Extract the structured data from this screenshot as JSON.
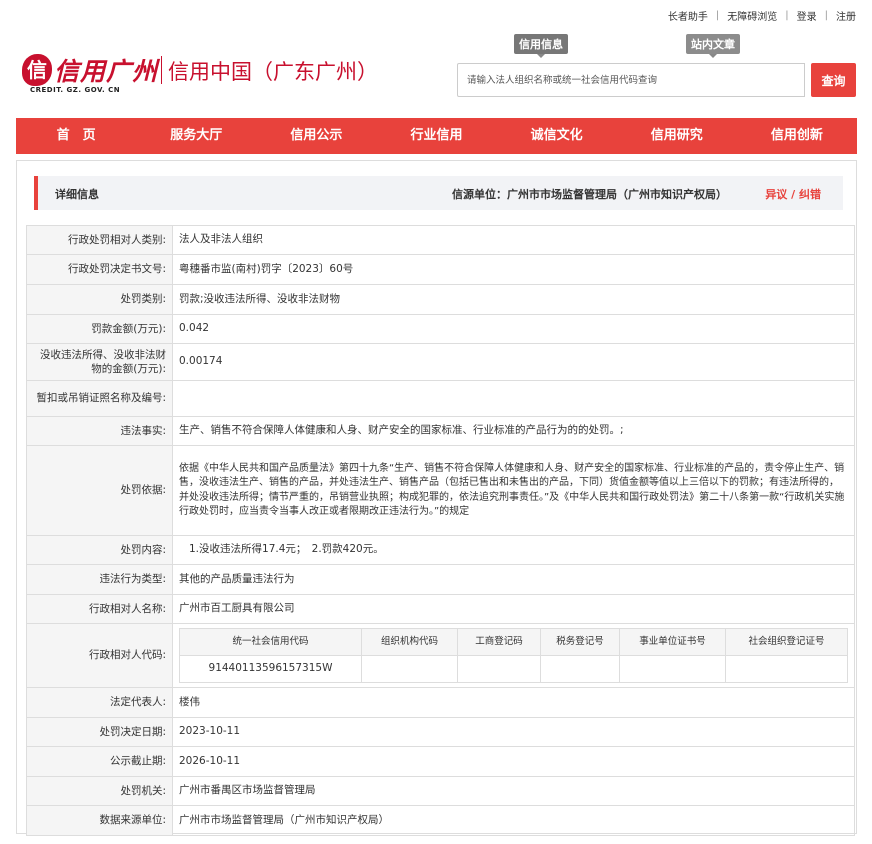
{
  "toplinks": {
    "elder": "长者助手",
    "accessible": "无障碍浏览",
    "login": "登录",
    "register": "注册"
  },
  "logo": {
    "mark": "信",
    "name": "信用广州",
    "en": "CREDIT. GZ. GOV. CN",
    "sub": "信用中国（广东广州）"
  },
  "search": {
    "tab1": "信用信息",
    "tab2": "站内文章",
    "placeholder": "请输入法人组织名称或统一社会信用代码查询",
    "button": "查询"
  },
  "nav": [
    "首　页",
    "服务大厅",
    "信用公示",
    "行业信用",
    "诚信文化",
    "信用研究",
    "信用创新"
  ],
  "detail": {
    "title": "详细信息",
    "source": "信源单位：广州市市场监督管理局（广州市知识产权局）",
    "objection": "异议 / 纠错"
  },
  "rows": {
    "r1": {
      "label": "行政处罚相对人类别:",
      "value": "法人及非法人组织"
    },
    "r2": {
      "label": "行政处罚决定书文号:",
      "value": "粤穗番市监(南村)罚字〔2023〕60号"
    },
    "r3": {
      "label": "处罚类别:",
      "value": "罚款;没收违法所得、没收非法财物"
    },
    "r4": {
      "label": "罚款金额(万元):",
      "value": "0.042"
    },
    "r5": {
      "label": "没收违法所得、没收非法财物的金额(万元):",
      "value": "0.00174"
    },
    "r6": {
      "label": "暂扣或吊销证照名称及编号:",
      "value": ""
    },
    "r7": {
      "label": "违法事实:",
      "value": "生产、销售不符合保障人体健康和人身、财产安全的国家标准、行业标准的产品行为的的处罚。;"
    },
    "r8": {
      "label": "处罚依据:",
      "value": "依据《中华人民共和国产品质量法》第四十九条“生产、销售不符合保障人体健康和人身、财产安全的国家标准、行业标准的产品的，责令停止生产、销售，没收违法生产、销售的产品，并处违法生产、销售产品（包括已售出和未售出的产品，下同）货值金额等值以上三倍以下的罚款；有违法所得的，并处没收违法所得；情节严重的，吊销营业执照；构成犯罪的，依法追究刑事责任。”及《中华人民共和国行政处罚法》第二十八条第一款“行政机关实施行政处罚时，应当责令当事人改正或者限期改正违法行为。”的规定"
    },
    "r9": {
      "label": "处罚内容:",
      "value": "1.没收违法所得17.4元；　2.罚款420元。"
    },
    "r10": {
      "label": "违法行为类型:",
      "value": "其他的产品质量违法行为"
    },
    "r11": {
      "label": "行政相对人名称:",
      "value": "广州市百工厨具有限公司"
    },
    "r12": {
      "label": "行政相对人代码:"
    },
    "r13": {
      "label": "法定代表人:",
      "value": "楼伟"
    },
    "r14": {
      "label": "处罚决定日期:",
      "value": "2023-10-11"
    },
    "r15": {
      "label": "公示截止期:",
      "value": "2026-10-11"
    },
    "r16": {
      "label": "处罚机关:",
      "value": "广州市番禺区市场监督管理局"
    },
    "r17": {
      "label": "数据来源单位:",
      "value": "广州市市场监督管理局（广州市知识产权局）"
    }
  },
  "codes": {
    "headers": [
      "统一社会信用代码",
      "组织机构代码",
      "工商登记码",
      "税务登记号",
      "事业单位证书号",
      "社会组织登记证号"
    ],
    "values": [
      "91440113596157315W",
      "",
      "",
      "",
      "",
      ""
    ]
  }
}
